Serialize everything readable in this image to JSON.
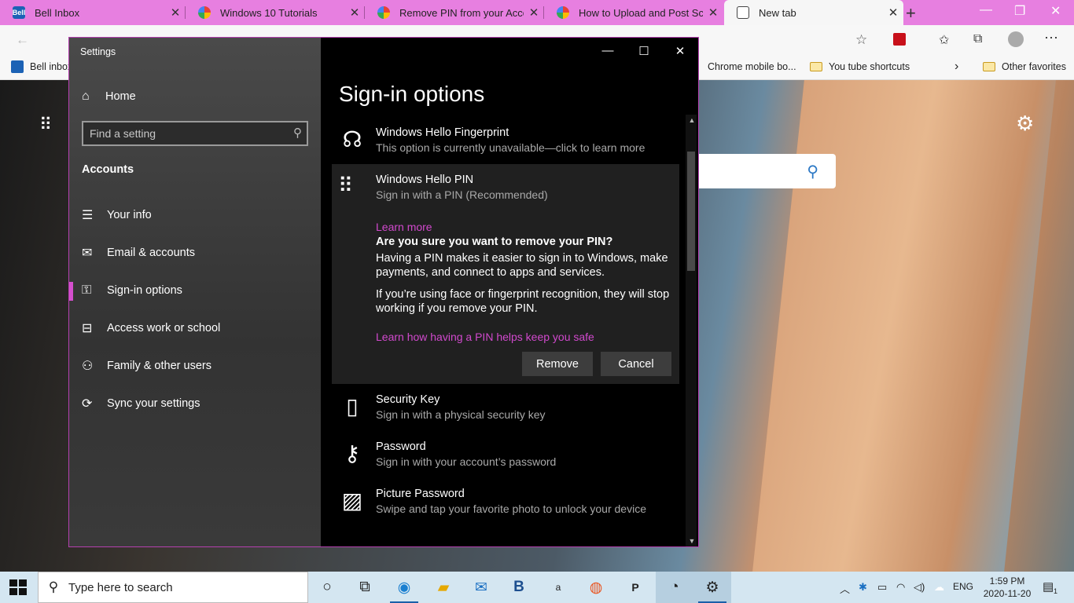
{
  "browser": {
    "tabs": [
      {
        "label": "Bell Inbox",
        "icon": "bell-icon"
      },
      {
        "label": "Windows 10 Tutorials",
        "icon": "flower-icon"
      },
      {
        "label": "Remove PIN from your Account",
        "icon": "flower-icon"
      },
      {
        "label": "How to Upload and Post Screenshots",
        "icon": "flower-icon"
      },
      {
        "label": "New tab",
        "icon": "newtab-icon"
      }
    ],
    "favorites": {
      "bell": "Bell inbox",
      "chrome": "Chrome mobile bo...",
      "youtube": "You tube shortcuts",
      "other": "Other favorites"
    },
    "accent_color": "#e77fe0"
  },
  "settings": {
    "window_title": "Settings",
    "home": "Home",
    "search_placeholder": "Find a setting",
    "section": "Accounts",
    "nav": [
      {
        "label": "Your info",
        "icon": "person-card-icon"
      },
      {
        "label": "Email & accounts",
        "icon": "mail-icon"
      },
      {
        "label": "Sign-in options",
        "icon": "key-icon",
        "selected": true
      },
      {
        "label": "Access work or school",
        "icon": "briefcase-icon"
      },
      {
        "label": "Family & other users",
        "icon": "person-add-icon"
      },
      {
        "label": "Sync your settings",
        "icon": "sync-icon"
      }
    ],
    "page_title": "Sign-in options",
    "options": {
      "fingerprint": {
        "name": "Windows Hello Fingerprint",
        "desc": "This option is currently unavailable—click to learn more"
      },
      "pin": {
        "name": "Windows Hello PIN",
        "desc": "Sign in with a PIN (Recommended)",
        "learn_more": "Learn more",
        "question": "Are you sure you want to remove your PIN?",
        "para1": "Having a PIN makes it easier to sign in to Windows, make payments, and connect to apps and services.",
        "para2": "If you’re using face or fingerprint recognition, they will stop working if you remove your PIN.",
        "safe_link": "Learn how having a PIN helps keep you safe",
        "remove": "Remove",
        "cancel": "Cancel"
      },
      "security_key": {
        "name": "Security Key",
        "desc": "Sign in with a physical security key"
      },
      "password": {
        "name": "Password",
        "desc": "Sign in with your account’s password"
      },
      "picture": {
        "name": "Picture Password",
        "desc": "Swipe and tap your favorite photo to unlock your device"
      }
    },
    "link_color": "#d149cd"
  },
  "taskbar": {
    "search_placeholder": "Type here to search",
    "language": "ENG",
    "time": "1:59 PM",
    "date": "2020-11-20",
    "notification_count": "1"
  }
}
